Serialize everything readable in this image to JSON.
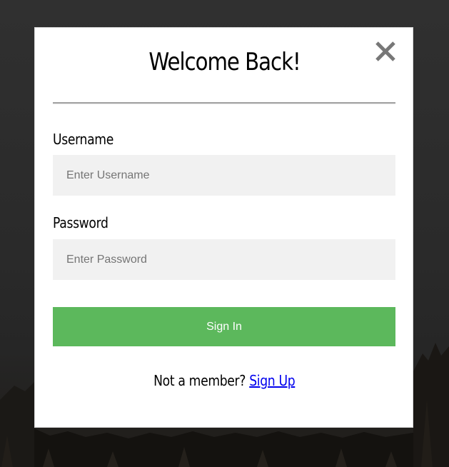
{
  "modal": {
    "title": "Welcome Back!",
    "close_icon": "close-icon"
  },
  "form": {
    "username": {
      "label": "Username",
      "placeholder": "Enter Username",
      "value": ""
    },
    "password": {
      "label": "Password",
      "placeholder": "Enter Password",
      "value": ""
    },
    "submit_label": "Sign In"
  },
  "footer": {
    "prompt": "Not a member?",
    "link_label": "Sign Up"
  },
  "colors": {
    "accent": "#5cb85c",
    "input_background": "#f1f1f1",
    "link": "#0000ee",
    "overlay": "#2c2c2c"
  }
}
